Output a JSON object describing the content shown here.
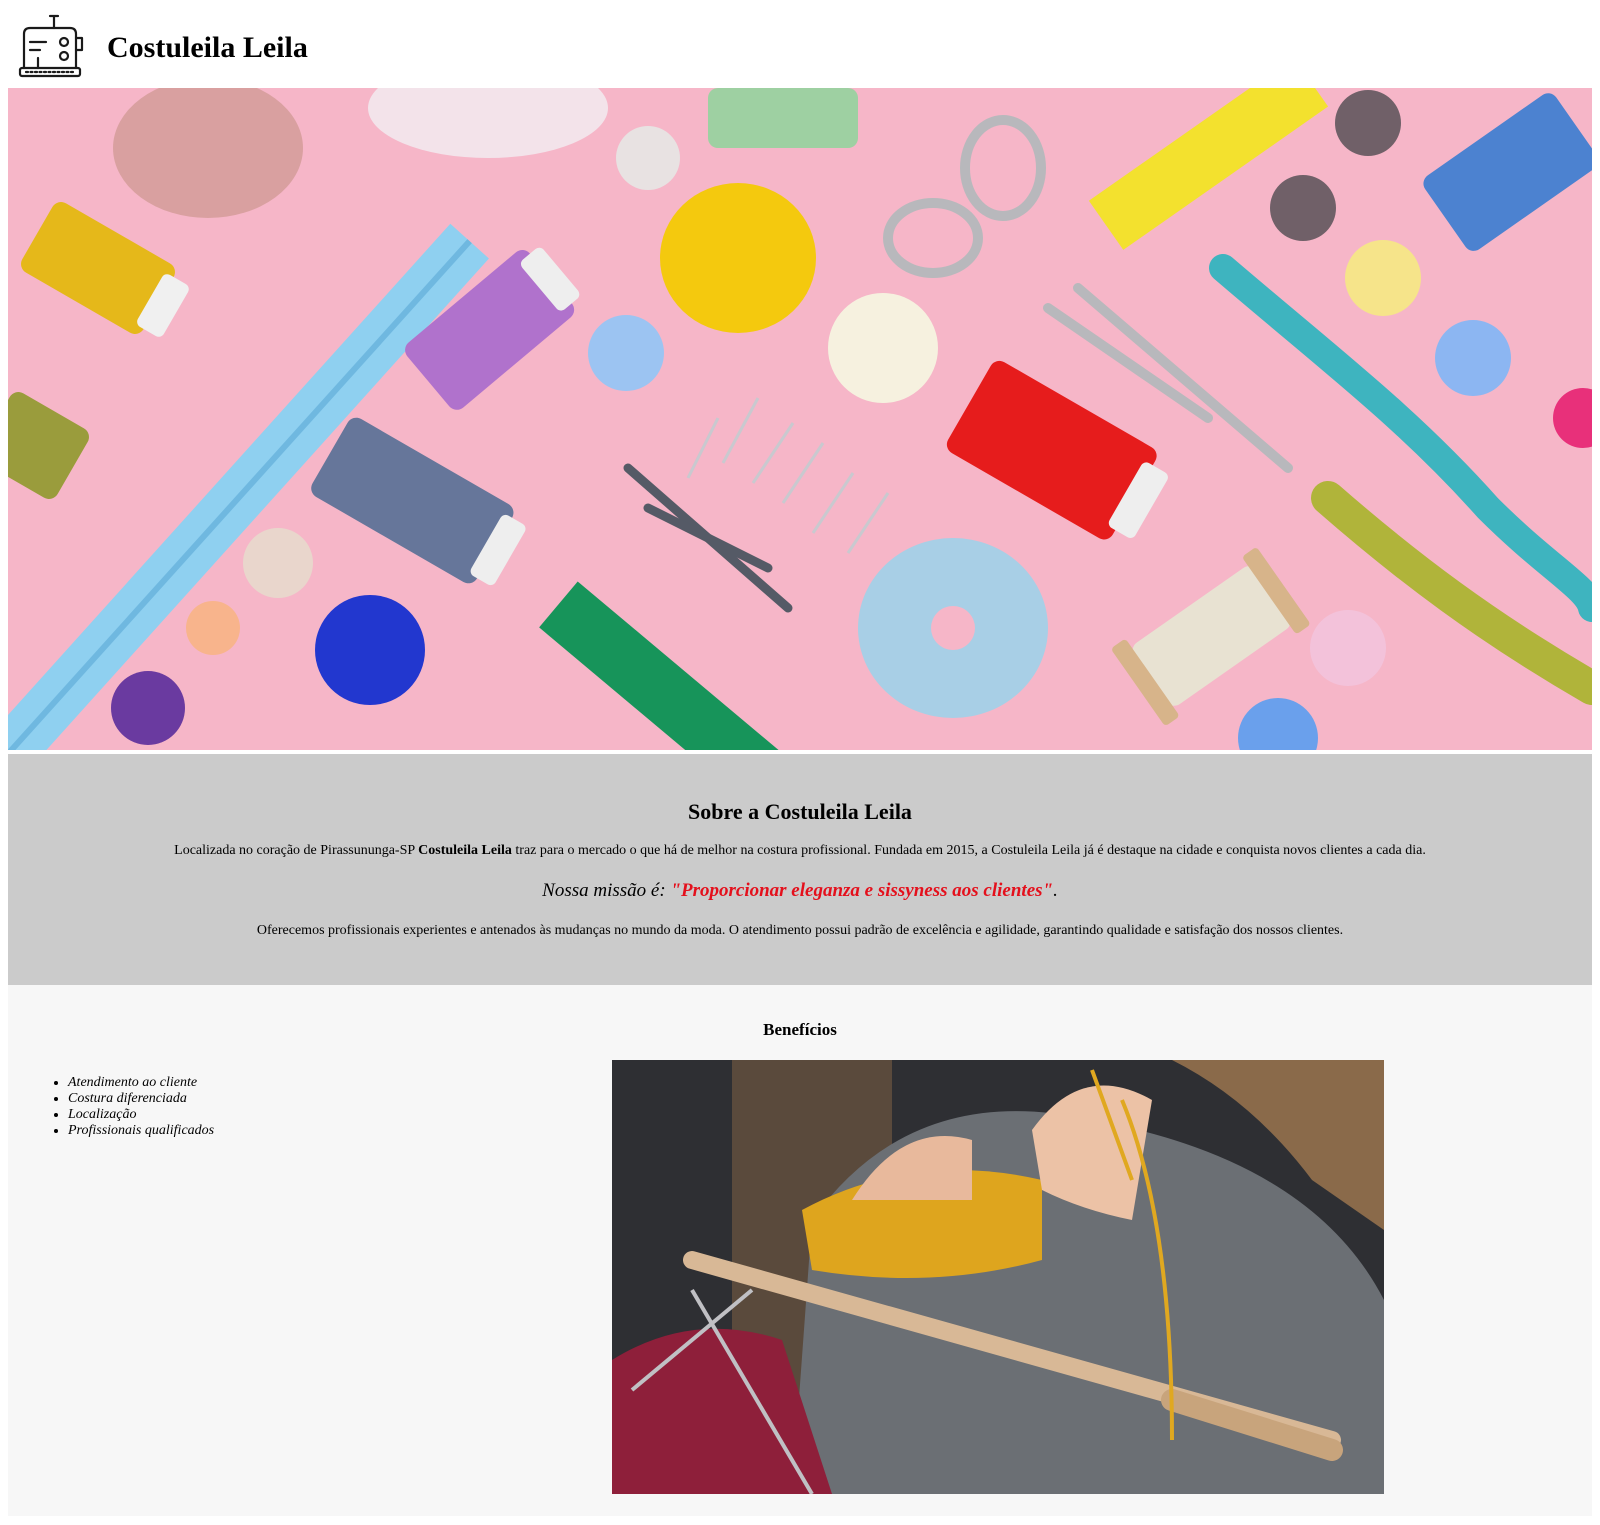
{
  "header": {
    "title": "Costuleila Leila",
    "logo_icon": "sewing-machine-icon"
  },
  "hero": {
    "image": "sewing-supplies-flatlay",
    "background_color": "#f6b6c8"
  },
  "about": {
    "heading": "Sobre a Costuleila Leila",
    "intro_before": "Localizada no coração de Pirassununga-SP ",
    "intro_brand": "Costuleila Leila",
    "intro_after": " traz para o mercado o que há de melhor na costura profissional. Fundada em 2015, a Costuleila Leila já é destaque na cidade e conquista novos clientes a cada dia.",
    "mission_label": "Nossa missão é: ",
    "mission_quote": "\"Proporcionar eleganza e sissyness aos clientes\"",
    "mission_end": ".",
    "services": "Oferecemos profissionais experientes e antenados às mudanças no mundo da moda. O atendimento possui padrão de excelência e agilidade, garantindo qualidade e satisfação dos nossos clientes.",
    "background_color": "#cbcbcb",
    "quote_color": "#e4101c"
  },
  "benefits": {
    "heading": "Benefícios",
    "items": [
      "Atendimento ao cliente",
      "Costura diferenciada",
      "Localização",
      "Profissionais qualificados"
    ],
    "image": "knitting-hands-photo",
    "background_color": "#f7f7f7"
  }
}
